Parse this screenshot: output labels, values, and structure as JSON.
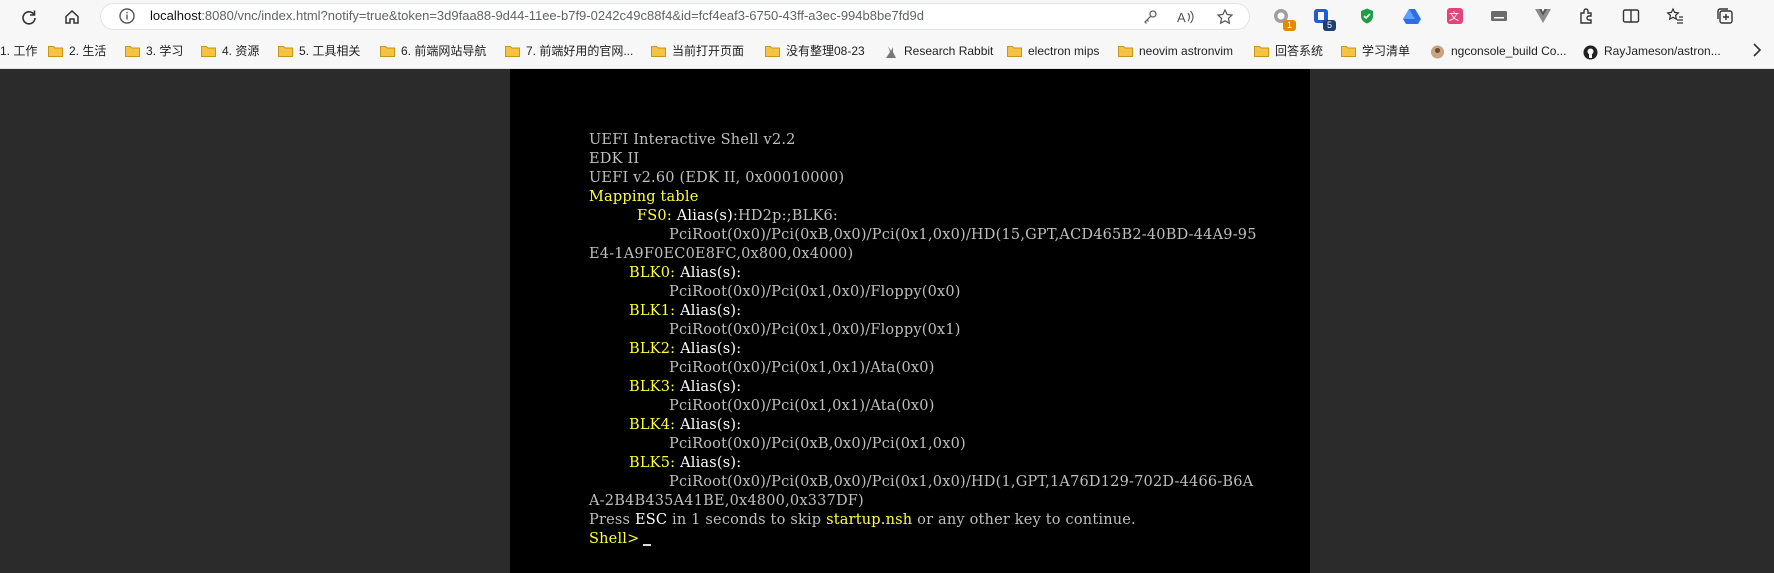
{
  "browser": {
    "url_host": "localhost",
    "url_rest": ":8080/vnc/index.html?notify=true&token=3d9faa88-9d44-11ee-b7f9-0242c49c88f4&id=fcf4eaf3-6750-43ff-a3ec-994b8be7fd9d",
    "extensions": [
      {
        "icon": "ext-badge-icon",
        "badge": "1",
        "badge_color": "#e08a00"
      },
      {
        "icon": "ext-tab-counter-icon",
        "badge": "5",
        "badge_color": "#1d3f72"
      }
    ]
  },
  "bookmarks": [
    {
      "label": "1. 工作",
      "type": "folder"
    },
    {
      "label": "2. 生活",
      "type": "folder"
    },
    {
      "label": "3. 学习",
      "type": "folder"
    },
    {
      "label": "4. 资源",
      "type": "folder"
    },
    {
      "label": "5. 工具相关",
      "type": "folder"
    },
    {
      "label": "6. 前端网站导航",
      "type": "folder"
    },
    {
      "label": "7. 前端好用的官网...",
      "type": "folder"
    },
    {
      "label": "当前打开页面",
      "type": "folder"
    },
    {
      "label": "没有整理08-23",
      "type": "folder"
    },
    {
      "label": "Research Rabbit",
      "type": "link"
    },
    {
      "label": "electron mips",
      "type": "folder"
    },
    {
      "label": "neovim astronvim",
      "type": "folder"
    },
    {
      "label": "回答系统",
      "type": "folder"
    },
    {
      "label": "学习清单",
      "type": "folder"
    },
    {
      "label": "ngconsole_build Co...",
      "type": "link"
    },
    {
      "label": "RayJameson/astron...",
      "type": "link"
    }
  ],
  "console": {
    "header": [
      "UEFI Interactive Shell v2.2",
      "EDK II",
      "UEFI v2.60 (EDK II, 0x00010000)"
    ],
    "mapping_title": "Mapping table",
    "fs0": {
      "name": "FS0",
      "alias_label": "Alias(s)",
      "alias_value": ":HD2p:;BLK6:",
      "path1": "PciRoot(0x0)/Pci(0xB,0x0)/Pci(0x1,0x0)/HD(15,GPT,ACD465B2-40BD-44A9-95",
      "path2": "E4-1A9F0EC0E8FC,0x800,0x4000)"
    },
    "blk0": {
      "name": "BLK0",
      "alias_label": "Alias(s)",
      "path": "PciRoot(0x0)/Pci(0x1,0x0)/Floppy(0x0)"
    },
    "blk1": {
      "name": "BLK1",
      "alias_label": "Alias(s)",
      "path": "PciRoot(0x0)/Pci(0x1,0x0)/Floppy(0x1)"
    },
    "blk2": {
      "name": "BLK2",
      "alias_label": "Alias(s)",
      "path": "PciRoot(0x0)/Pci(0x1,0x1)/Ata(0x0)"
    },
    "blk3": {
      "name": "BLK3",
      "alias_label": "Alias(s)",
      "path": "PciRoot(0x0)/Pci(0x1,0x1)/Ata(0x0)"
    },
    "blk4": {
      "name": "BLK4",
      "alias_label": "Alias(s)",
      "path": "PciRoot(0x0)/Pci(0xB,0x0)/Pci(0x1,0x0)"
    },
    "blk5": {
      "name": "BLK5",
      "alias_label": "Alias(s)",
      "path1": "PciRoot(0x0)/Pci(0xB,0x0)/Pci(0x1,0x0)/HD(1,GPT,1A76D129-702D-4466-B6A",
      "path2": "A-2B4B435A41BE,0x4800,0x337DF)"
    },
    "press": {
      "p1": "Press ",
      "key": "ESC",
      "p2": " in 1 seconds to skip ",
      "file": "startup.nsh",
      "p3": " or any other key to continue."
    },
    "prompt": "Shell>"
  }
}
